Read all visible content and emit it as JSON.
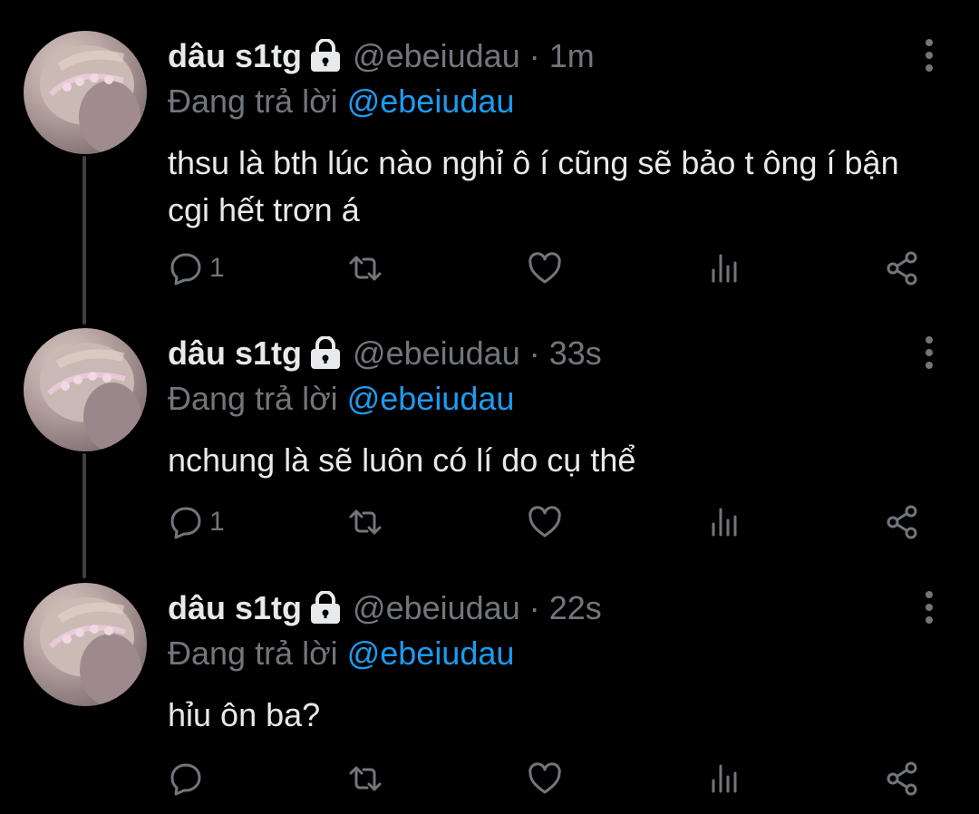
{
  "colors": {
    "background": "#000000",
    "text_primary": "#e7e9ea",
    "text_secondary": "#71767b",
    "accent": "#1d9bf0",
    "thread_line": "#3e4144"
  },
  "icons": {
    "lock": "lock-icon",
    "more": "more-icon",
    "reply": "reply-icon",
    "retweet": "retweet-icon",
    "like": "heart-icon",
    "views": "analytics-icon",
    "share": "share-icon"
  },
  "tweets": [
    {
      "display_name": "dâu s1tg",
      "handle": "@ebeiudau",
      "separator": "·",
      "time": "1m",
      "replying_prefix": "Đang trả lời",
      "replying_to": "@ebeiudau",
      "text": "thsu là bth lúc nào nghỉ ô í cũng sẽ bảo t ông í bận cgi hết trơn á",
      "reply_count": "1"
    },
    {
      "display_name": "dâu s1tg",
      "handle": "@ebeiudau",
      "separator": "·",
      "time": "33s",
      "replying_prefix": "Đang trả lời",
      "replying_to": "@ebeiudau",
      "text": "nchung là sẽ luôn có lí do cụ thể",
      "reply_count": "1"
    },
    {
      "display_name": "dâu s1tg",
      "handle": "@ebeiudau",
      "separator": "·",
      "time": "22s",
      "replying_prefix": "Đang trả lời",
      "replying_to": "@ebeiudau",
      "text": "hỉu ôn ba?",
      "reply_count": ""
    }
  ]
}
